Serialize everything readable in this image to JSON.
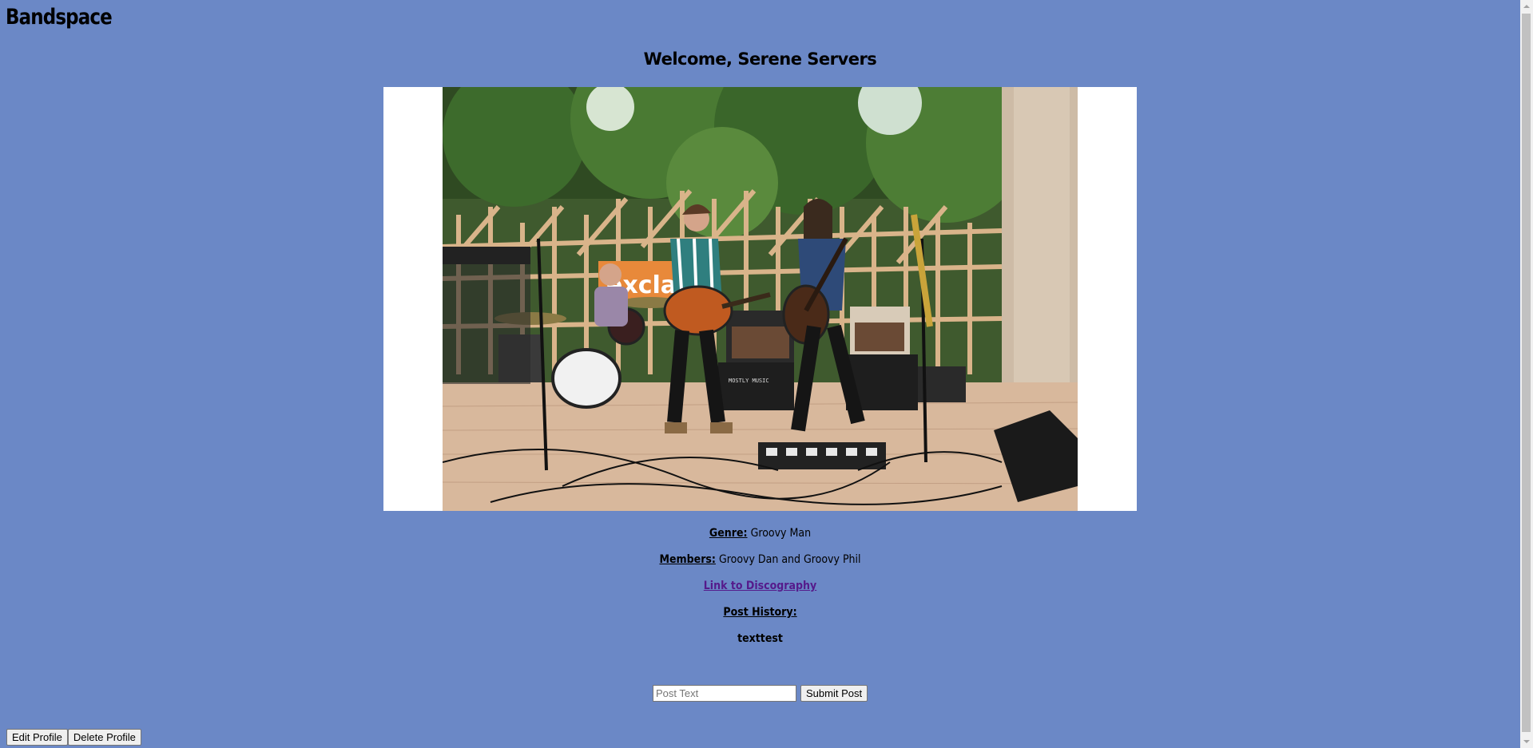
{
  "app": {
    "brand": "Bandspace"
  },
  "profile": {
    "welcome": "Welcome, Serene Servers",
    "genre_label": "Genre:",
    "genre_value": "Groovy Man",
    "members_label": "Members:",
    "members_value": "Groovy Dan and Groovy Phil",
    "discography_link": "Link to Discography",
    "post_history_label": "Post History:",
    "posts": [
      "texttest"
    ]
  },
  "post_form": {
    "placeholder": "Post Text",
    "value": "",
    "submit_label": "Submit Post"
  },
  "profile_actions": {
    "edit_label": "Edit Profile",
    "delete_label": "Delete Profile"
  },
  "colors": {
    "background": "#6b88c6",
    "link_visited": "#551a8b",
    "photo_frame": "#ffffff"
  }
}
